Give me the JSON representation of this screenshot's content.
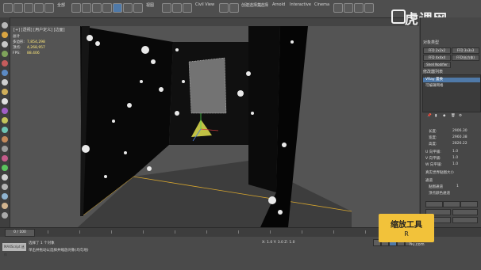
{
  "toolbar": {
    "selection_filter": "全部",
    "view_dropdown": "视图",
    "named_selection": "创建选择集",
    "menu_items": [
      "Civil View",
      "选择",
      "Arnold",
      "Interactive",
      "Cinema"
    ]
  },
  "brand": {
    "name": "虎课网"
  },
  "viewport": {
    "label": "[+] [透视] [用户定义] [边面]",
    "stats": [
      {
        "label": "总计",
        "value": ""
      },
      {
        "label": "多边形:",
        "value": "7,854,298"
      },
      {
        "label": "顶点:",
        "value": "4,268,957"
      },
      {
        "label": "FPS:",
        "value": "88.406"
      }
    ]
  },
  "command_panel": {
    "title": "对象类型",
    "buttons": [
      "FFD 2x2x2",
      "FFD 3x3x3",
      "FFD 4x4x4",
      "FFD(长方体)",
      "Shell Nodifier"
    ],
    "modifier_list_title": "修改器列表",
    "modifier_selected": "VRay 置换",
    "modifier_second": "可编辑网格",
    "params": [
      {
        "label": "长度:",
        "value": "2906.30"
      },
      {
        "label": "宽度:",
        "value": "2960.38"
      },
      {
        "label": "高度:",
        "value": "2826.22"
      },
      {
        "label": "U 向平铺:",
        "value": "1.0"
      },
      {
        "label": "V 向平铺:",
        "value": "1.0"
      },
      {
        "label": "W 向平铺:",
        "value": "1.0"
      }
    ],
    "options": [
      "真实世界贴图大小",
      "通道",
      "贴图通道",
      "顶点颜色通道"
    ],
    "channel_value": "1"
  },
  "timeline": {
    "frame": "0 / 100"
  },
  "status": {
    "maxscript": "MAXScript 迷你",
    "line1": "选择了 1 个对象",
    "line2": "单击并拖动以选择并缩放对象(均匀地)",
    "coords": "X: 1.0   Y: 3.0   Z: 1.0"
  },
  "hint": {
    "title": "缩放工具",
    "key": "R"
  },
  "watermark": "hu.com"
}
